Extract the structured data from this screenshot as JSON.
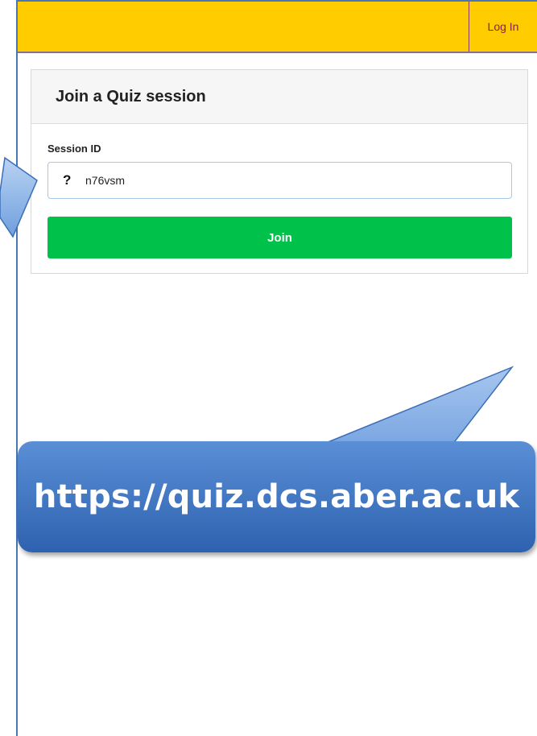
{
  "header": {
    "login_label": "Log In"
  },
  "card": {
    "title": "Join a Quiz session",
    "session_field": {
      "label": "Session ID",
      "icon": "question-icon",
      "value": "n76vsm"
    },
    "join_label": "Join"
  },
  "callout": {
    "url": "https://quiz.dcs.aber.ac.uk"
  },
  "colors": {
    "topbar": "#ffcc00",
    "join_button": "#00c24a",
    "callout": "#3d73c2"
  }
}
